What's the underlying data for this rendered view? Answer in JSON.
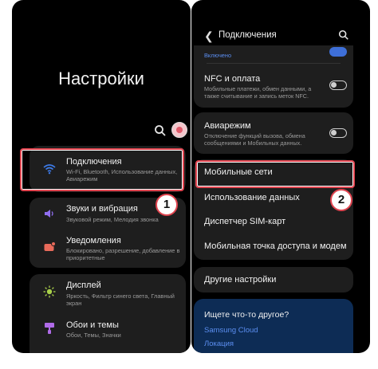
{
  "left": {
    "title": "Настройки",
    "items": [
      {
        "title": "Подключения",
        "sub": "Wi-Fi, Bluetooth, Использование данных, Авиарежим"
      },
      {
        "title": "Звуки и вибрация",
        "sub": "Звуковой режим, Мелодия звонка"
      },
      {
        "title": "Уведомления",
        "sub": "Блокировано, разрешение, добавление в приоритетные"
      },
      {
        "title": "Дисплей",
        "sub": "Яркость, Фильтр синего света, Главный экран"
      },
      {
        "title": "Обои и темы",
        "sub": "Обои, Темы, Значки"
      }
    ],
    "badge": "1"
  },
  "right": {
    "header": "Подключения",
    "partial_top": "Включено",
    "items": [
      {
        "title": "NFC и оплата",
        "sub": "Мобильные платежи, обмен данными, а также считывание и запись меток NFC."
      },
      {
        "title": "Авиарежим",
        "sub": "Отключение функций вызова, обмена сообщениями и Мобильных данных."
      },
      {
        "title": "Мобильные сети"
      },
      {
        "title": "Использование данных"
      },
      {
        "title": "Диспетчер SIM-карт"
      },
      {
        "title": "Мобильная точка доступа и модем"
      },
      {
        "title": "Другие настройки"
      }
    ],
    "suggest_title": "Ищете что-то другое?",
    "suggest_link1": "Samsung Cloud",
    "suggest_link2": "Локация",
    "badge": "2"
  },
  "colors": {
    "accent_red": "#e0444f",
    "toggle_on": "#3e6fd8",
    "card": "#1e1e1e"
  }
}
